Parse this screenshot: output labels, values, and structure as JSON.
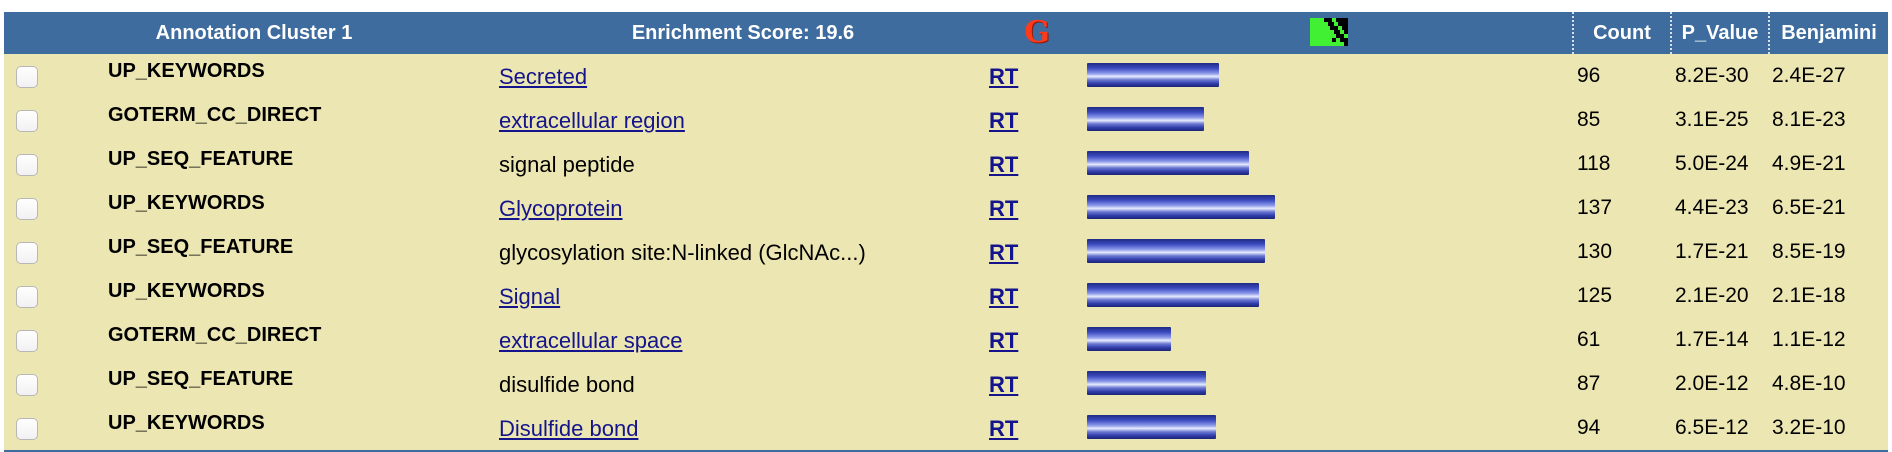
{
  "header": {
    "cluster_title": "Annotation Cluster 1",
    "enrichment_score": "Enrichment Score: 19.6",
    "g_label": "G",
    "col_count": "Count",
    "col_pvalue": "P_Value",
    "col_benjamini": "Benjamini"
  },
  "colors": {
    "header_bg": "#3e6c9e",
    "body_bg": "#ece7b2",
    "link": "#14148c",
    "heatmap_green": "#41ef33"
  },
  "icons": {
    "g_logo": "gene-list-g-icon",
    "heatmap": "heatmap-icon"
  },
  "rt_label": "RT",
  "bar_scale_max_count": 137,
  "rows": [
    {
      "category": "UP_KEYWORDS",
      "term": "Secreted",
      "link": true,
      "count": "96",
      "p_value": "8.2E-30",
      "benjamini": "2.4E-27"
    },
    {
      "category": "GOTERM_CC_DIRECT",
      "term": "extracellular region",
      "link": true,
      "count": "85",
      "p_value": "3.1E-25",
      "benjamini": "8.1E-23"
    },
    {
      "category": "UP_SEQ_FEATURE",
      "term": "signal peptide",
      "link": false,
      "count": "118",
      "p_value": "5.0E-24",
      "benjamini": "4.9E-21"
    },
    {
      "category": "UP_KEYWORDS",
      "term": "Glycoprotein",
      "link": true,
      "count": "137",
      "p_value": "4.4E-23",
      "benjamini": "6.5E-21"
    },
    {
      "category": "UP_SEQ_FEATURE",
      "term": "glycosylation site:N-linked (GlcNAc...)",
      "link": false,
      "count": "130",
      "p_value": "1.7E-21",
      "benjamini": "8.5E-19"
    },
    {
      "category": "UP_KEYWORDS",
      "term": "Signal",
      "link": true,
      "count": "125",
      "p_value": "2.1E-20",
      "benjamini": "2.1E-18"
    },
    {
      "category": "GOTERM_CC_DIRECT",
      "term": "extracellular space",
      "link": true,
      "count": "61",
      "p_value": "1.7E-14",
      "benjamini": "1.1E-12"
    },
    {
      "category": "UP_SEQ_FEATURE",
      "term": "disulfide bond",
      "link": false,
      "count": "87",
      "p_value": "2.0E-12",
      "benjamini": "4.8E-10"
    },
    {
      "category": "UP_KEYWORDS",
      "term": "Disulfide bond",
      "link": true,
      "count": "94",
      "p_value": "6.5E-12",
      "benjamini": "3.2E-10"
    }
  ]
}
